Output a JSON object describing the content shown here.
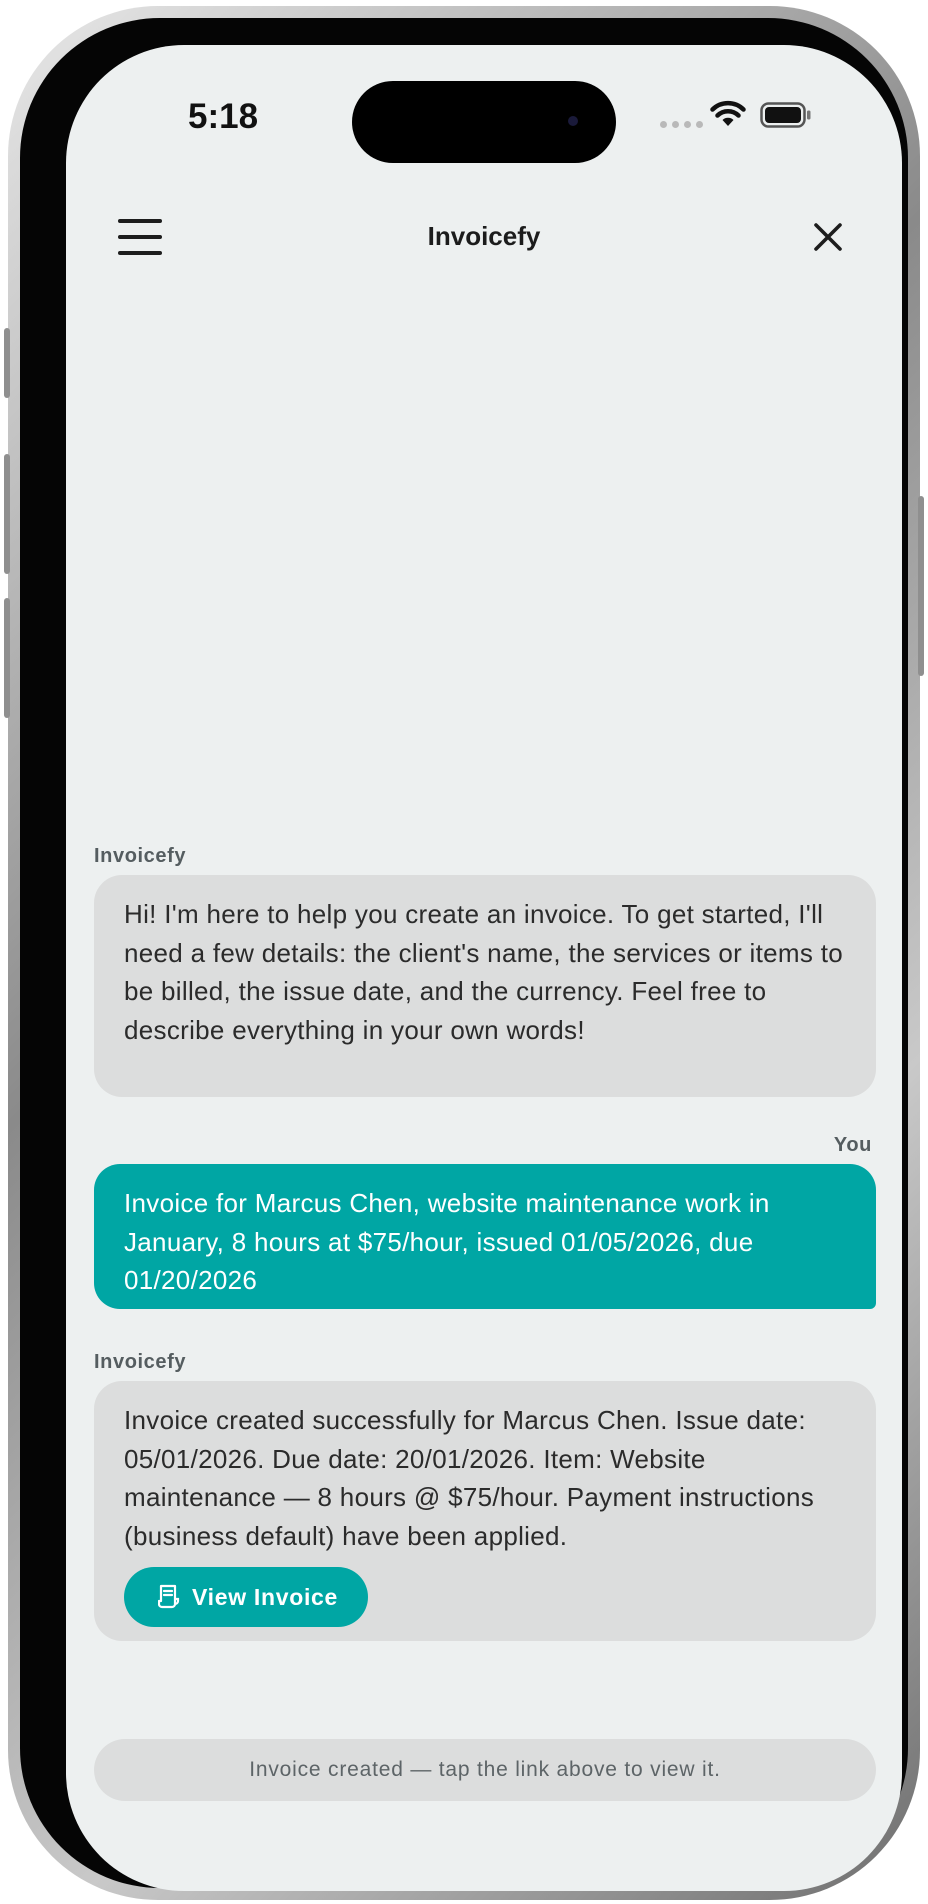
{
  "status_bar": {
    "time": "5:18"
  },
  "navbar": {
    "title": "Invoicefy",
    "menu_icon": "hamburger-menu-icon",
    "close_icon": "close-icon"
  },
  "messages": [
    {
      "sender": "Invoicefy",
      "role": "assistant",
      "text": "Hi! I'm here to help you create an invoice. To get started, I'll need a few details: the client's name, the services or items to be billed, the issue date, and the currency. Feel free to describe everything in your own words!"
    },
    {
      "sender": "You",
      "role": "user",
      "text": "Invoice for Marcus Chen, website maintenance work in January, 8 hours at $75/hour, issued 01/05/2026, due 01/20/2026"
    },
    {
      "sender": "Invoicefy",
      "role": "assistant",
      "text": "Invoice created successfully for Marcus Chen. Issue date: 05/01/2026. Due date: 20/01/2026. Item: Website maintenance — 8 hours @ $75/hour. Payment instructions (business default) have been applied.",
      "action_label": "View Invoice",
      "action_icon": "receipt-icon"
    }
  ],
  "footer": {
    "note": "Invoice created — tap the link above to view it."
  },
  "colors": {
    "accent": "#00a6a4",
    "background": "#edf0f0",
    "bot_bubble": "#dcdddd"
  }
}
